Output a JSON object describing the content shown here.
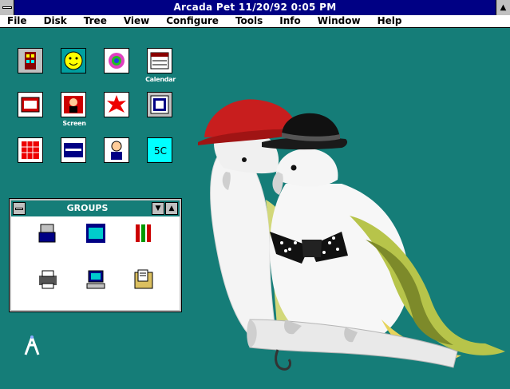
{
  "window": {
    "title": "Arcada Pet  11/20/92  0:05 PM"
  },
  "menu": [
    "File",
    "Disk",
    "Tree",
    "View",
    "Configure",
    "Tools",
    "Info",
    "Window",
    "Help"
  ],
  "desktop_icons": [
    {
      "label": "",
      "icon": "building-icon"
    },
    {
      "label": "",
      "icon": "smiley-face-icon"
    },
    {
      "label": "",
      "icon": "colorful-disk-icon"
    },
    {
      "label": "Calendar",
      "icon": "calendar-icon"
    },
    {
      "label": "",
      "icon": "red-window-icon"
    },
    {
      "label": "Screen",
      "icon": "screen-figure-icon"
    },
    {
      "label": "",
      "icon": "red-burst-icon"
    },
    {
      "label": "",
      "icon": "framed-window-icon"
    },
    {
      "label": "",
      "icon": "red-grid-icon"
    },
    {
      "label": "",
      "icon": "blue-window-icon"
    },
    {
      "label": "",
      "icon": "user-figure-icon"
    },
    {
      "label": "",
      "icon": "cyan-card-icon"
    }
  ],
  "groups_window": {
    "title": "GROUPS",
    "items": [
      {
        "label": "",
        "icon": "tools-stack-icon",
        "selected": false
      },
      {
        "label": "",
        "icon": "accessories-icon",
        "selected": true
      },
      {
        "label": "",
        "icon": "games-bars-icon",
        "selected": false
      },
      {
        "label": "",
        "icon": "printer-icon",
        "selected": false
      },
      {
        "label": "",
        "icon": "desktop-computer-icon",
        "selected": false
      },
      {
        "label": "",
        "icon": "folder-document-icon",
        "selected": false
      }
    ]
  },
  "bottom_icon": {
    "label": "",
    "icon": "antenna-icon"
  }
}
